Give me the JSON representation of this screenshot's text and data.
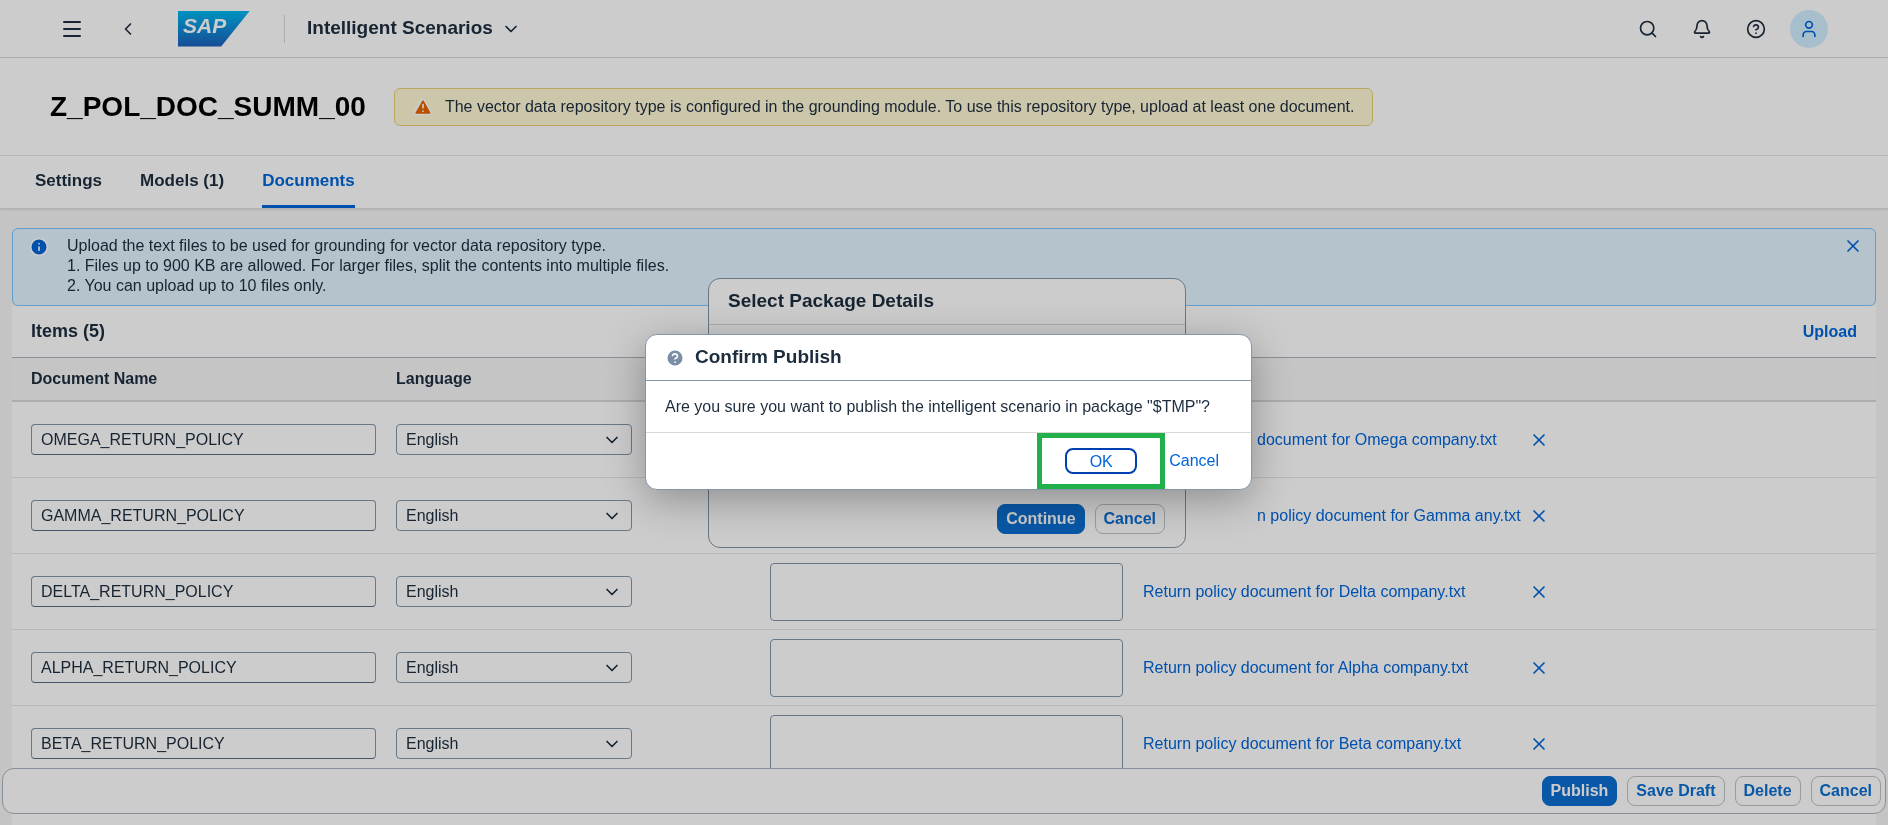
{
  "shell": {
    "logo": "SAP",
    "app_title": "Intelligent Scenarios"
  },
  "header": {
    "title": "Z_POL_DOC_SUMM_00",
    "warning": "The vector data repository type is configured in the grounding module. To use this repository type, upload at least one document."
  },
  "tabs": [
    {
      "label": "Settings",
      "selected": false
    },
    {
      "label": "Models (1)",
      "selected": false
    },
    {
      "label": "Documents",
      "selected": true
    }
  ],
  "info": {
    "lines": [
      "Upload the text files to be used for grounding for vector data repository type.",
      "1. Files up to 900 KB are allowed. For larger files, split the contents into multiple files.",
      "2. You can upload up to 10 files only."
    ]
  },
  "table": {
    "title": "Items (5)",
    "upload": "Upload",
    "columns": [
      "Document Name",
      "Language"
    ],
    "rows": [
      {
        "name": "OMEGA_RETURN_POLICY",
        "language": "English",
        "file": "document for Omega company.txt",
        "covered": true
      },
      {
        "name": "GAMMA_RETURN_POLICY",
        "language": "English",
        "file": "n policy document for Gamma any.txt",
        "covered": true
      },
      {
        "name": "DELTA_RETURN_POLICY",
        "language": "English",
        "file": "Return policy document for Delta company.txt",
        "covered": false
      },
      {
        "name": "ALPHA_RETURN_POLICY",
        "language": "English",
        "file": "Return policy document for Alpha company.txt",
        "covered": false
      },
      {
        "name": "BETA_RETURN_POLICY",
        "language": "English",
        "file": "Return policy document for Beta company.txt",
        "covered": false
      }
    ]
  },
  "footer": {
    "buttons": [
      {
        "label": "Publish",
        "kind": "primary"
      },
      {
        "label": "Save Draft",
        "kind": "ghost"
      },
      {
        "label": "Delete",
        "kind": "ghost"
      },
      {
        "label": "Cancel",
        "kind": "ghost"
      }
    ]
  },
  "package_dialog": {
    "title": "Select Package Details",
    "buttons": [
      {
        "label": "Continue",
        "kind": "primary"
      },
      {
        "label": "Cancel",
        "kind": "ghost"
      }
    ]
  },
  "confirm_dialog": {
    "title": "Confirm Publish",
    "message": "Are you sure you want to publish the intelligent scenario in package \"$TMP\"?",
    "ok": "OK",
    "cancel": "Cancel",
    "ok_highlighted": true
  }
}
